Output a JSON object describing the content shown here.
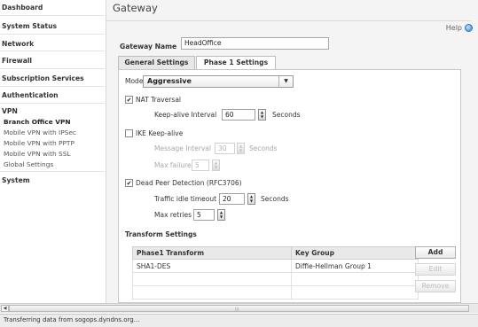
{
  "sidebar": {
    "items": [
      {
        "label": "Dashboard"
      },
      {
        "label": "System Status"
      },
      {
        "label": "Network"
      },
      {
        "label": "Firewall"
      },
      {
        "label": "Subscription Services"
      },
      {
        "label": "Authentication"
      },
      {
        "label": "VPN"
      },
      {
        "label": "System"
      }
    ],
    "vpn_subitems": [
      {
        "label": "Branch Office VPN"
      },
      {
        "label": "Mobile VPN with IPSec"
      },
      {
        "label": "Mobile VPN with PPTP"
      },
      {
        "label": "Mobile VPN with SSL"
      },
      {
        "label": "Global Settings"
      }
    ]
  },
  "page": {
    "title": "Gateway",
    "help_label": "Help"
  },
  "gateway_name": {
    "label": "Gateway Name",
    "value": "HeadOffice"
  },
  "tabs": [
    {
      "label": "General Settings"
    },
    {
      "label": "Phase 1 Settings"
    }
  ],
  "mode": {
    "label": "Mode",
    "value": "Aggressive"
  },
  "nat_traversal": {
    "label": "NAT Traversal",
    "checked": true,
    "keepalive_label": "Keep-alive Interval",
    "keepalive_value": "60",
    "unit": "Seconds"
  },
  "ike_keepalive": {
    "label": "IKE Keep-alive",
    "checked": false,
    "message_interval_label": "Message Interval",
    "message_interval_value": "30",
    "unit": "Seconds",
    "max_failures_label": "Max failures",
    "max_failures_value": "5"
  },
  "dpd": {
    "label": "Dead Peer Detection (RFC3706)",
    "checked": true,
    "idle_label": "Traffic idle timeout",
    "idle_value": "20",
    "unit": "Seconds",
    "retries_label": "Max retries",
    "retries_value": "5"
  },
  "transform": {
    "section_title": "Transform Settings",
    "columns": [
      "Phase1 Transform",
      "Key Group"
    ],
    "rows": [
      [
        "SHA1-DES",
        "Diffie-Hellman Group 1"
      ],
      [
        "",
        ""
      ],
      [
        "",
        ""
      ]
    ],
    "buttons": {
      "add": "Add",
      "edit": "Edit",
      "remove": "Remove"
    }
  },
  "status_bar": {
    "text": "Transferring data from sogops.dyndns.org..."
  }
}
